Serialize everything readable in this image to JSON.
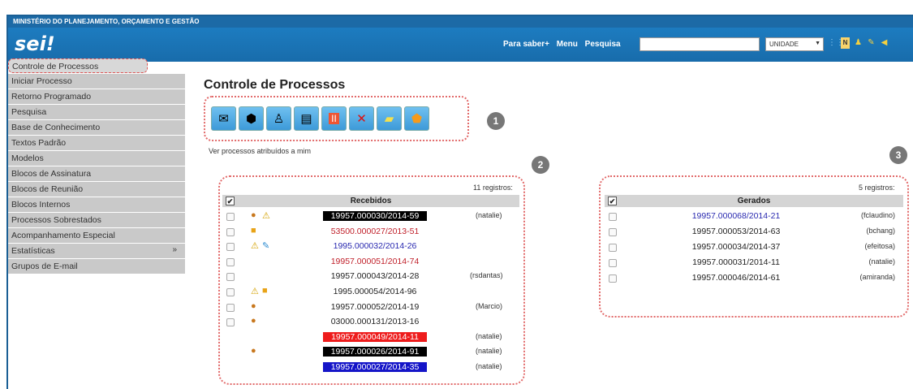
{
  "topbar": {
    "ministry": "MINISTÉRIO DO PLANEJAMENTO, ORÇAMENTO E GESTÃO"
  },
  "header": {
    "logo": "sei!",
    "links": [
      "Para saber+",
      "Menu",
      "Pesquisa"
    ],
    "search_value": "",
    "unit_select": "UNIDADE",
    "icons": [
      "grid-icon",
      "notification-icon",
      "user-icon",
      "tools-icon",
      "exit-icon"
    ]
  },
  "sidebar": {
    "items": [
      {
        "label": "Controle de Processos"
      },
      {
        "label": "Iniciar Processo"
      },
      {
        "label": "Retorno Programado"
      },
      {
        "label": "Pesquisa"
      },
      {
        "label": "Base de Conhecimento"
      },
      {
        "label": "Textos Padrão"
      },
      {
        "label": "Modelos"
      },
      {
        "label": "Blocos de Assinatura"
      },
      {
        "label": "Blocos de Reunião"
      },
      {
        "label": "Blocos Internos"
      },
      {
        "label": "Processos Sobrestados"
      },
      {
        "label": "Acompanhamento Especial"
      },
      {
        "label": "Estatísticas",
        "more": "»"
      },
      {
        "label": "Grupos de E-mail"
      }
    ]
  },
  "main": {
    "title": "Controle de Processos",
    "subtitle": "Ver processos atribuídos a mim",
    "toolbar_icons": [
      "send-process-icon",
      "update-andamento-icon",
      "assign-process-icon",
      "include-in-block-icon",
      "sobrestar-icon",
      "conclude-process-icon",
      "note-icon",
      "mark-icon"
    ],
    "markers": [
      "1",
      "2",
      "3"
    ]
  },
  "received": {
    "count_label": "11 registros:",
    "header": "Recebidos",
    "rows": [
      {
        "num": "19957.000030/2014-59",
        "user": "(natalie)",
        "style": "black",
        "icons": [
          "●",
          "⚠"
        ],
        "checkbox": true
      },
      {
        "num": "53500.000027/2013-51",
        "user": "",
        "style": "red",
        "icons": [
          "■"
        ],
        "checkbox": true
      },
      {
        "num": "1995.000032/2014-26",
        "user": "",
        "style": "blue",
        "icons": [
          "⚠",
          "✎"
        ],
        "checkbox": true
      },
      {
        "num": "19957.000051/2014-74",
        "user": "",
        "style": "red",
        "icons": [],
        "checkbox": true
      },
      {
        "num": "19957.000043/2014-28",
        "user": "(rsdantas)",
        "style": "plain",
        "icons": [],
        "checkbox": true
      },
      {
        "num": "1995.000054/2014-96",
        "user": "",
        "style": "plain",
        "icons": [
          "⚠",
          "■"
        ],
        "checkbox": true
      },
      {
        "num": "19957.000052/2014-19",
        "user": "(Marcio)",
        "style": "plain",
        "icons": [
          "●"
        ],
        "checkbox": true
      },
      {
        "num": "03000.000131/2013-16",
        "user": "",
        "style": "plain",
        "icons": [
          "●"
        ],
        "checkbox": true
      },
      {
        "num": "19957.000049/2014-11",
        "user": "(natalie)",
        "style": "redbg",
        "icons": [],
        "checkbox": false
      },
      {
        "num": "19957.000026/2014-91",
        "user": "(natalie)",
        "style": "black",
        "icons": [
          "●"
        ],
        "checkbox": false
      },
      {
        "num": "19957.000027/2014-35",
        "user": "(natalie)",
        "style": "bluebg",
        "icons": [],
        "checkbox": false
      }
    ]
  },
  "generated": {
    "count_label": "5 registros:",
    "header": "Gerados",
    "rows": [
      {
        "num": "19957.000068/2014-21",
        "user": "(fclaudino)",
        "style": "blue"
      },
      {
        "num": "19957.000053/2014-63",
        "user": "(bchang)",
        "style": "plain"
      },
      {
        "num": "19957.000034/2014-37",
        "user": "(efeitosa)",
        "style": "plain"
      },
      {
        "num": "19957.000031/2014-11",
        "user": "(natalie)",
        "style": "plain"
      },
      {
        "num": "19957.000046/2014-61",
        "user": "(amiranda)",
        "style": "plain"
      }
    ]
  },
  "colors": {
    "header_blue": "#1d7cc0",
    "link_blue": "#2a2ab0",
    "link_red": "#c0202a",
    "highlight_red": "#ee1c1c",
    "highlight_blue": "#1515c8",
    "highlight_black": "#000000"
  }
}
